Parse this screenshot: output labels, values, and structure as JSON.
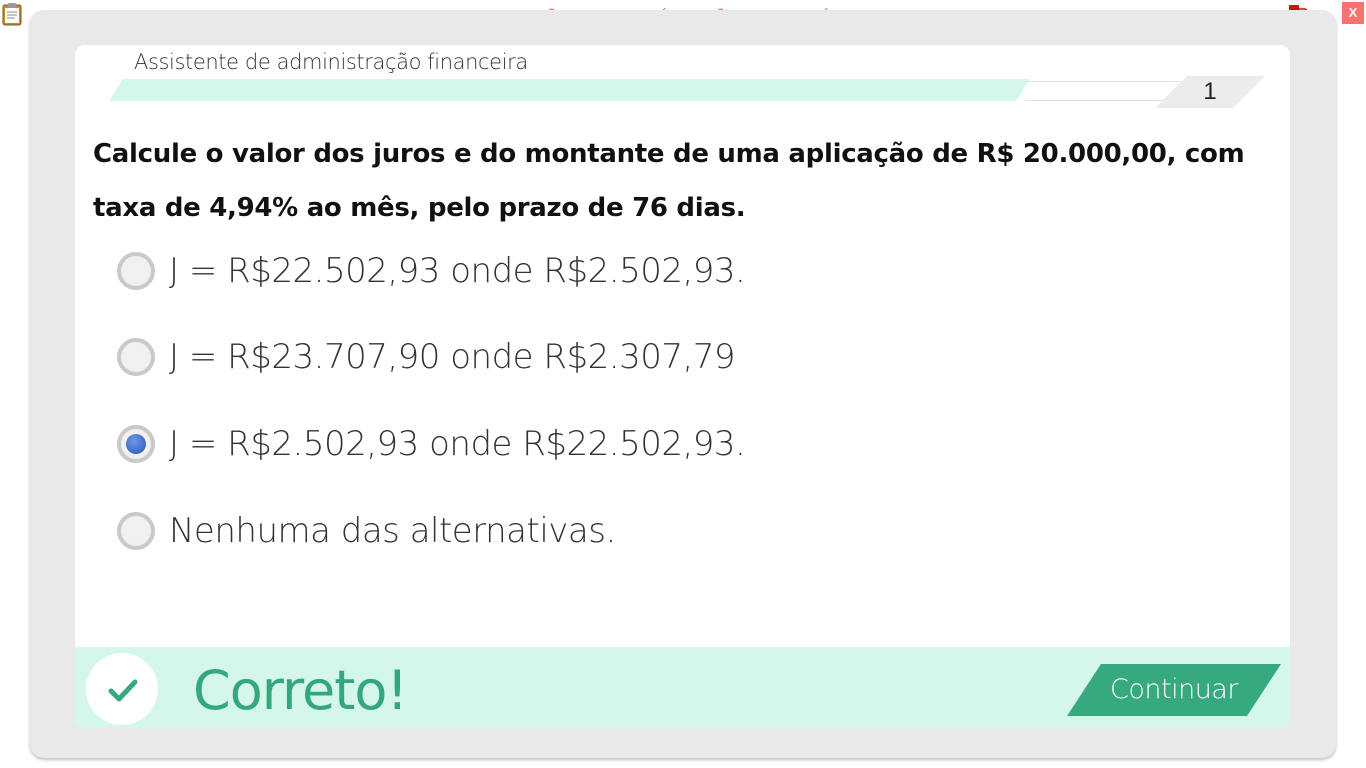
{
  "banner": "VERSÃO PARA FUNCIONÁRIOS - NÃO COMERCIALIZÁVEL",
  "window": {
    "close_label": "X"
  },
  "course": {
    "title": "Assistente de administração financeira",
    "progress": 0.83,
    "question_number": "1"
  },
  "question": {
    "text": "Calcule o valor dos juros e do montante de uma aplicação de R$ 20.000,00, com taxa de 4,94% ao mês, pelo prazo de 76 dias."
  },
  "options": [
    {
      "label": "J = R$22.502,93 onde R$2.502,93.",
      "selected": false
    },
    {
      "label": "J = R$23.707,90 onde R$2.307,79",
      "selected": false
    },
    {
      "label": "J = R$2.502,93 onde R$22.502,93.",
      "selected": true
    },
    {
      "label": "Nenhuma das alternativas.",
      "selected": false
    }
  ],
  "feedback": {
    "status_text": "Correto!",
    "icon": "check-icon",
    "continue_label": "Continuar"
  },
  "colors": {
    "accent_green": "#37a97f",
    "feedback_bg": "#d5f6ea",
    "banner_red": "#f0545c",
    "radio_selected": "#2b57b8"
  }
}
